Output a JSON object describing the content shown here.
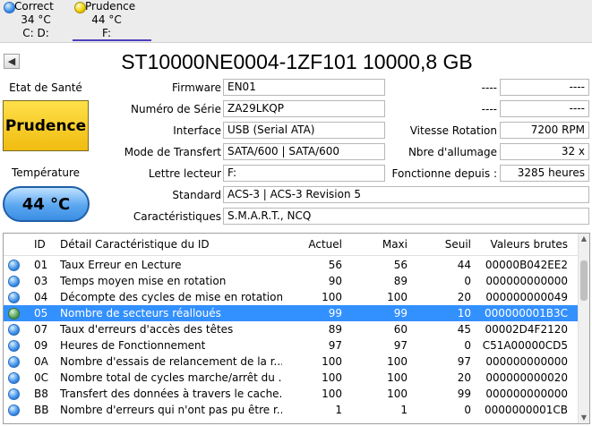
{
  "disk_tabs": [
    {
      "status": "Correct",
      "temp": "34 °C",
      "drives": "C: D:",
      "dot": "blue",
      "active": false
    },
    {
      "status": "Prudence",
      "temp": "44 °C",
      "drives": "F:",
      "dot": "yellow",
      "active": true
    }
  ],
  "nav": {
    "prev_icon": "◀"
  },
  "title": "ST10000NE0004-1ZF101 10000,8 GB",
  "health": {
    "label": "Etat de Santé",
    "value": "Prudence",
    "color": "#f5c518"
  },
  "temperature": {
    "label": "Température",
    "value": "44 °C",
    "color": "#4a9cec"
  },
  "fields": {
    "firmware": {
      "label": "Firmware",
      "value": "EN01"
    },
    "serial": {
      "label": "Numéro de Série",
      "value": "ZA29LKQP"
    },
    "interface": {
      "label": "Interface",
      "value": "USB (Serial ATA)"
    },
    "transfer": {
      "label": "Mode de Transfert",
      "value": "SATA/600 | SATA/600"
    },
    "drive_letter": {
      "label": "Lettre lecteur",
      "value": "F:"
    },
    "standard": {
      "label": "Standard",
      "value": "ACS-3 | ACS-3 Revision 5"
    },
    "features": {
      "label": "Caractéristiques",
      "value": "S.M.A.R.T., NCQ"
    },
    "blank1": {
      "label": "----",
      "value": "----"
    },
    "blank2": {
      "label": "----",
      "value": "----"
    },
    "rotation": {
      "label": "Vitesse Rotation",
      "value": "7200 RPM"
    },
    "power_count": {
      "label": "Nbre d'allumage",
      "value": "32 x"
    },
    "power_hours": {
      "label": "Fonctionne depuis :",
      "value": "3285 heures"
    }
  },
  "smart": {
    "headers": {
      "id": "ID",
      "name": "Détail Caractéristique du ID",
      "current": "Actuel",
      "worst": "Maxi",
      "threshold": "Seuil",
      "raw": "Valeurs brutes"
    },
    "rows": [
      {
        "dot": "blue",
        "id": "01",
        "name": "Taux Erreur en Lecture",
        "current": "56",
        "worst": "56",
        "threshold": "44",
        "raw": "00000B042EE2"
      },
      {
        "dot": "blue",
        "id": "03",
        "name": "Temps moyen mise en rotation",
        "current": "90",
        "worst": "89",
        "threshold": "0",
        "raw": "000000000000"
      },
      {
        "dot": "blue",
        "id": "04",
        "name": "Décompte des cycles de mise en rotation",
        "current": "100",
        "worst": "100",
        "threshold": "20",
        "raw": "000000000049"
      },
      {
        "dot": "green",
        "id": "05",
        "name": "Nombre de secteurs réalloués",
        "current": "99",
        "worst": "99",
        "threshold": "10",
        "raw": "000000001B3C",
        "selected": true
      },
      {
        "dot": "blue",
        "id": "07",
        "name": "Taux d'erreurs d'accès des têtes",
        "current": "89",
        "worst": "60",
        "threshold": "45",
        "raw": "00002D4F2120"
      },
      {
        "dot": "blue",
        "id": "09",
        "name": "Heures de Fonctionnement",
        "current": "97",
        "worst": "97",
        "threshold": "0",
        "raw": "C51A00000CD5"
      },
      {
        "dot": "blue",
        "id": "0A",
        "name": "Nombre d'essais de relancement de la r...",
        "current": "100",
        "worst": "100",
        "threshold": "97",
        "raw": "000000000000"
      },
      {
        "dot": "blue",
        "id": "0C",
        "name": "Nombre total de cycles marche/arrêt du ...",
        "current": "100",
        "worst": "100",
        "threshold": "20",
        "raw": "000000000020"
      },
      {
        "dot": "blue",
        "id": "B8",
        "name": "Transfert des données à travers le cache...",
        "current": "100",
        "worst": "100",
        "threshold": "99",
        "raw": "000000000000"
      },
      {
        "dot": "blue",
        "id": "BB",
        "name": "Nombre d'erreurs qui n'ont pas pu être r...",
        "current": "1",
        "worst": "1",
        "threshold": "0",
        "raw": "0000000001CB"
      }
    ]
  }
}
